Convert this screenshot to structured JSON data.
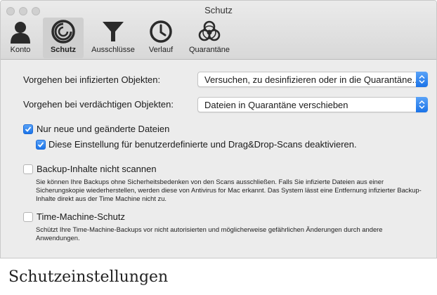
{
  "window": {
    "title": "Schutz"
  },
  "tabs": [
    {
      "label": "Konto",
      "icon": "person-icon"
    },
    {
      "label": "Schutz",
      "icon": "shield-icon"
    },
    {
      "label": "Ausschlüsse",
      "icon": "funnel-icon"
    },
    {
      "label": "Verlauf",
      "icon": "clock-icon"
    },
    {
      "label": "Quarantäne",
      "icon": "biohazard-icon"
    }
  ],
  "active_tab": "Schutz",
  "settings": {
    "infected_label": "Vorgehen bei infizierten Objekten:",
    "infected_value": "Versuchen, zu desinfizieren oder in die Quarantäne...",
    "suspicious_label": "Vorgehen bei verdächtigen Objekten:",
    "suspicious_value": "Dateien in Quarantäne verschieben",
    "new_changed": {
      "label": "Nur neue und geänderte Dateien",
      "checked": true
    },
    "disable_custom": {
      "label": "Diese Einstellung für benutzerdefinierte und Drag&Drop-Scans deaktivieren.",
      "checked": true
    },
    "backup": {
      "label": "Backup-Inhalte nicht scannen",
      "checked": false,
      "description": "Sie können Ihre Backups ohne Sicherheitsbedenken von den Scans ausschließen. Falls Sie infizierte Dateien aus einer Sicherungskopie wiederherstellen, werden diese von Antivirus for Mac erkannt. Das System lässt eine Entfernung infizierter Backup-Inhalte direkt aus der Time Machine nicht zu."
    },
    "time_machine": {
      "label": "Time-Machine-Schutz",
      "checked": false,
      "description": "Schützt Ihre Time-Machine-Backups vor nicht autorisierten und möglicherweise gefährlichen Änderungen durch andere Anwendungen."
    }
  },
  "caption": "Schutzeinstellungen",
  "colors": {
    "accent": "#1a73e8",
    "window_bg": "#ececec"
  }
}
